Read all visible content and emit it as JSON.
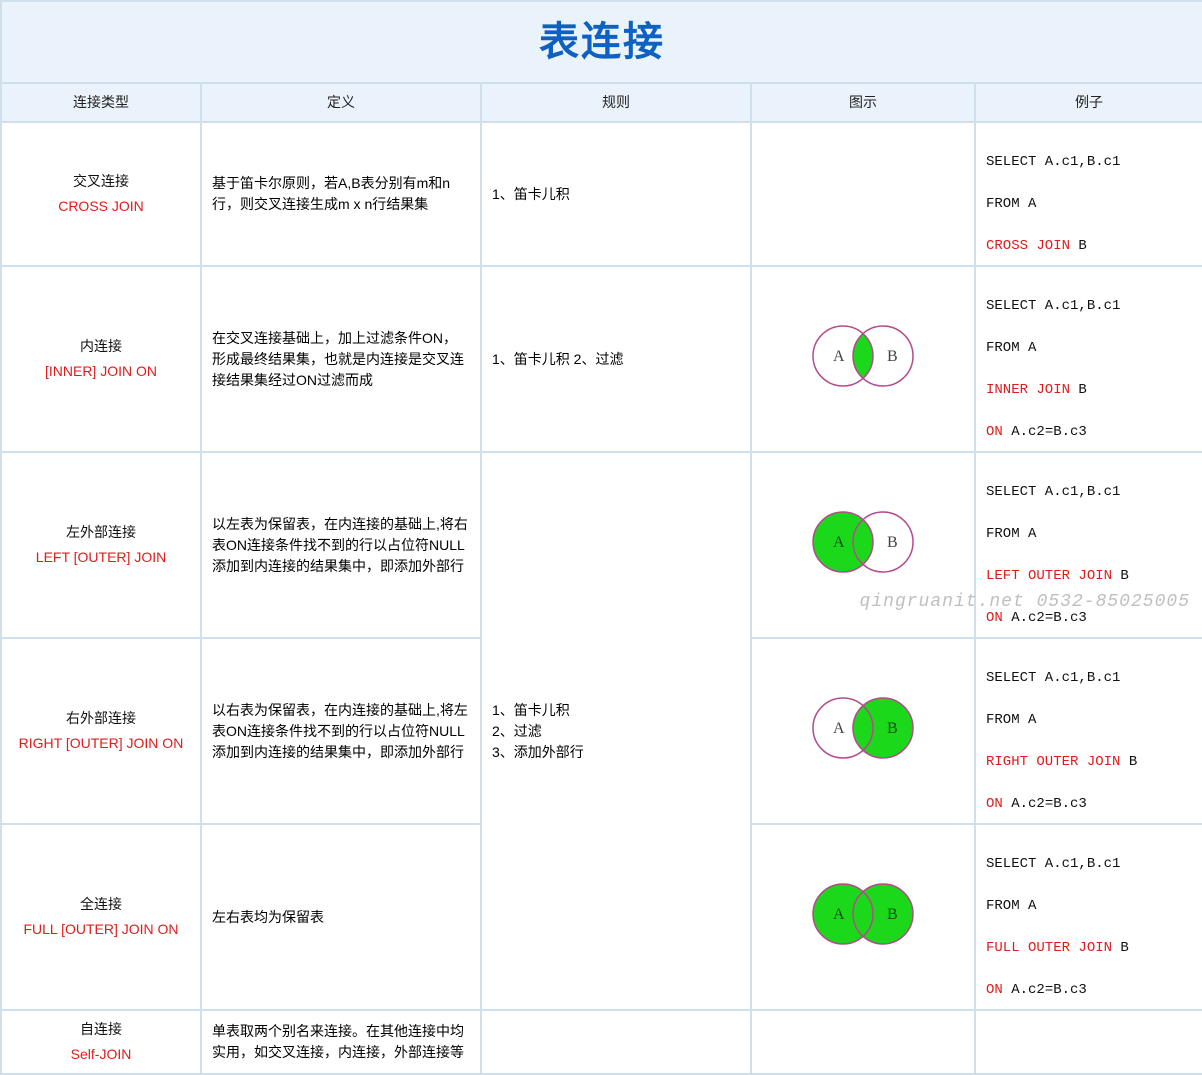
{
  "title": "表连接",
  "watermark": "qingruanit.net 0532-85025005",
  "headers": {
    "type": "连接类型",
    "definition": "定义",
    "rule": "规则",
    "diagram": "图示",
    "example": "例子"
  },
  "rows": {
    "cross": {
      "name_cn": "交叉连接",
      "name_en": "CROSS JOIN",
      "definition": "基于笛卡尔原则，若A,B表分别有m和n行，则交叉连接生成m x n行结果集",
      "rule": "1、笛卡儿积",
      "example_l1": "SELECT A.c1,B.c1",
      "example_l2": "FROM  A",
      "example_kw": "CROSS   JOIN",
      "example_tail": " B"
    },
    "inner": {
      "name_cn": "内连接",
      "name_en": "[INNER]  JOIN  ON",
      "definition": "在交叉连接基础上，加上过滤条件ON，形成最终结果集，也就是内连接是交叉连接结果集经过ON过滤而成",
      "rule": "1、笛卡儿积  2、过滤",
      "example_l1": "SELECT A.c1,B.c1",
      "example_l2": "FROM  A",
      "example_kw": "INNER   JOIN",
      "example_tail": " B",
      "example_on_kw": "ON",
      "example_on_tail": "  A.c2=B.c3"
    },
    "left": {
      "name_cn": "左外部连接",
      "name_en": "LEFT [OUTER] JOIN",
      "definition": "以左表为保留表，在内连接的基础上,将右表ON连接条件找不到的行以占位符NULL添加到内连接的结果集中，即添加外部行",
      "example_l1": "SELECT A.c1,B.c1",
      "example_l2": "FROM  A",
      "example_kw": "LEFT OUTER  JOIN",
      "example_tail": " B",
      "example_on_kw": "ON",
      "example_on_tail": "  A.c2=B.c3"
    },
    "right": {
      "name_cn": "右外部连接",
      "name_en": "RIGHT [OUTER] JOIN ON",
      "definition": "以右表为保留表，在内连接的基础上,将左表ON连接条件找不到的行以占位符NULL添加到内连接的结果集中，即添加外部行",
      "example_l1": "SELECT A.c1,B.c1",
      "example_l2": "FROM  A",
      "example_kw": "RIGHT OUTER JOIN",
      "example_tail": " B",
      "example_on_kw": "ON",
      "example_on_tail": "  A.c2=B.c3"
    },
    "outer_rule": "1、笛卡儿积\n2、过滤\n3、添加外部行",
    "full": {
      "name_cn": "全连接",
      "name_en": "FULL [OUTER] JOIN ON",
      "definition": "左右表均为保留表",
      "example_l1": "SELECT A.c1,B.c1",
      "example_l2": "FROM  A",
      "example_kw": "FULL OUTER  JOIN",
      "example_tail": " B",
      "example_on_kw": "ON",
      "example_on_tail": "  A.c2=B.c3"
    },
    "self": {
      "name_cn": "自连接",
      "name_en": "Self-JOIN",
      "definition": "单表取两个别名来连接。在其他连接中均实用，如交叉连接，内连接，外部连接等"
    }
  }
}
